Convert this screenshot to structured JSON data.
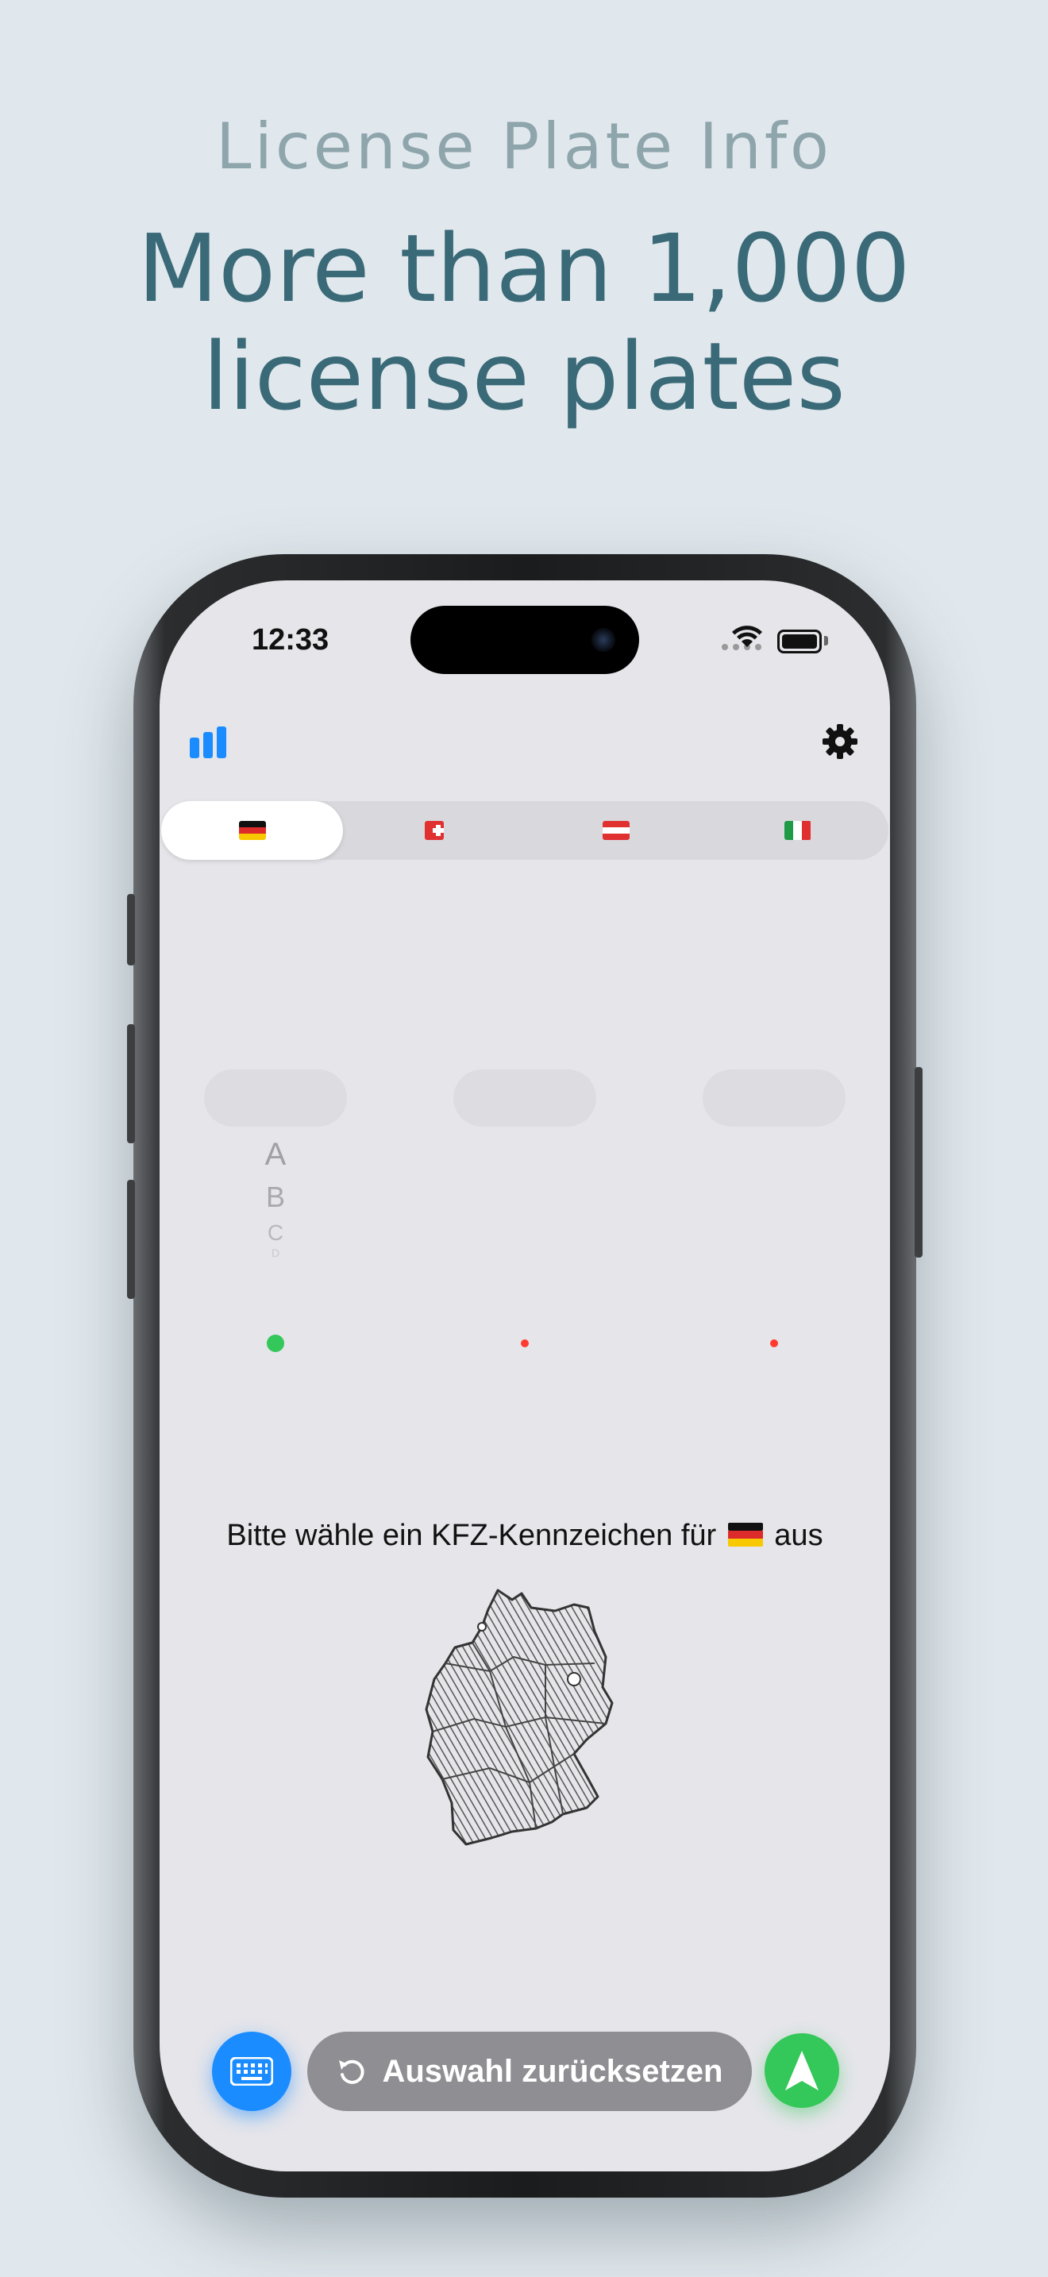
{
  "promo": {
    "subtitle": "License Plate Info",
    "headline_line1": "More than 1,000",
    "headline_line2": "license plates"
  },
  "status_bar": {
    "time": "12:33"
  },
  "toolbar": {
    "stats_icon": "bar-chart-icon",
    "settings_icon": "gear-icon"
  },
  "country_tabs": [
    {
      "country": "Germany",
      "flag": "de",
      "selected": true
    },
    {
      "country": "Switzerland",
      "flag": "ch",
      "selected": false
    },
    {
      "country": "Austria",
      "flag": "at",
      "selected": false
    },
    {
      "country": "Italy",
      "flag": "it",
      "selected": false
    }
  ],
  "picker": {
    "column1": [
      "A",
      "B",
      "C",
      "D"
    ]
  },
  "indicators": [
    {
      "color": "#34c759",
      "state": "active"
    },
    {
      "color": "#ff3b30",
      "state": "inactive"
    },
    {
      "color": "#ff3b30",
      "state": "inactive"
    }
  ],
  "prompt": {
    "before_flag": "Bitte wähle ein KFZ-Kennzeichen für",
    "after_flag": "aus"
  },
  "actions": {
    "keyboard_icon": "keyboard-icon",
    "reset_label": "Auswahl zurücksetzen",
    "reset_icon": "rotate-ccw-icon",
    "navigate_icon": "location-arrow-icon"
  },
  "colors": {
    "accent": "#1a8cff",
    "green": "#34c759",
    "red": "#ff3b30",
    "headline": "#3a6a78"
  }
}
